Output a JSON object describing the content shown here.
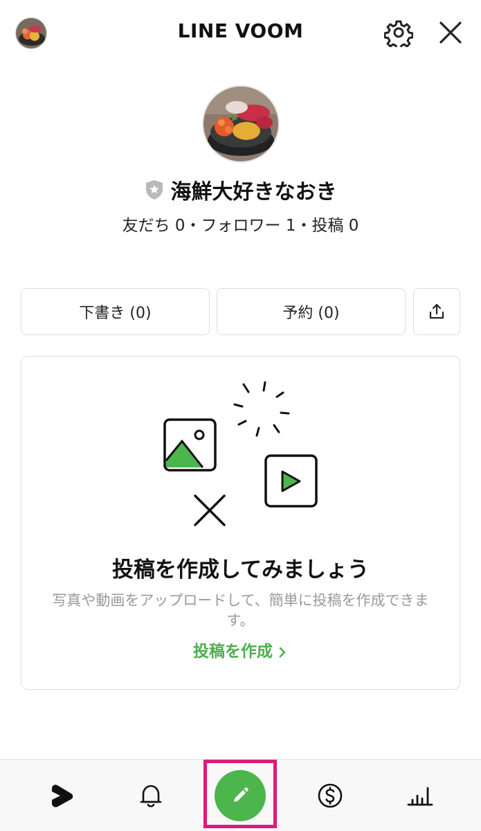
{
  "header": {
    "title": "LINE VOOM",
    "avatar_icon": "sushi-bowl-avatar",
    "settings_icon": "gear-icon",
    "close_icon": "close-icon"
  },
  "profile": {
    "name": "海鮮大好きなおき",
    "badge_icon": "shield-star-icon",
    "stats": "友だち 0・フォロワー 1・投稿 0"
  },
  "actions": {
    "drafts_label": "下書き (0)",
    "scheduled_label": "予約 (0)",
    "share_icon": "share-icon"
  },
  "empty_state": {
    "heading": "投稿を作成してみましょう",
    "description": "写真や動画をアップロードして、簡単に投稿を作成できます。",
    "link_label": "投稿を作成"
  },
  "bottom_nav": {
    "items": [
      "voom-home-icon",
      "bell-icon",
      "pencil-icon",
      "dollar-coin-icon",
      "bar-chart-icon"
    ],
    "highlight_color": "#e0197d",
    "accent_color": "#4cb54c"
  }
}
